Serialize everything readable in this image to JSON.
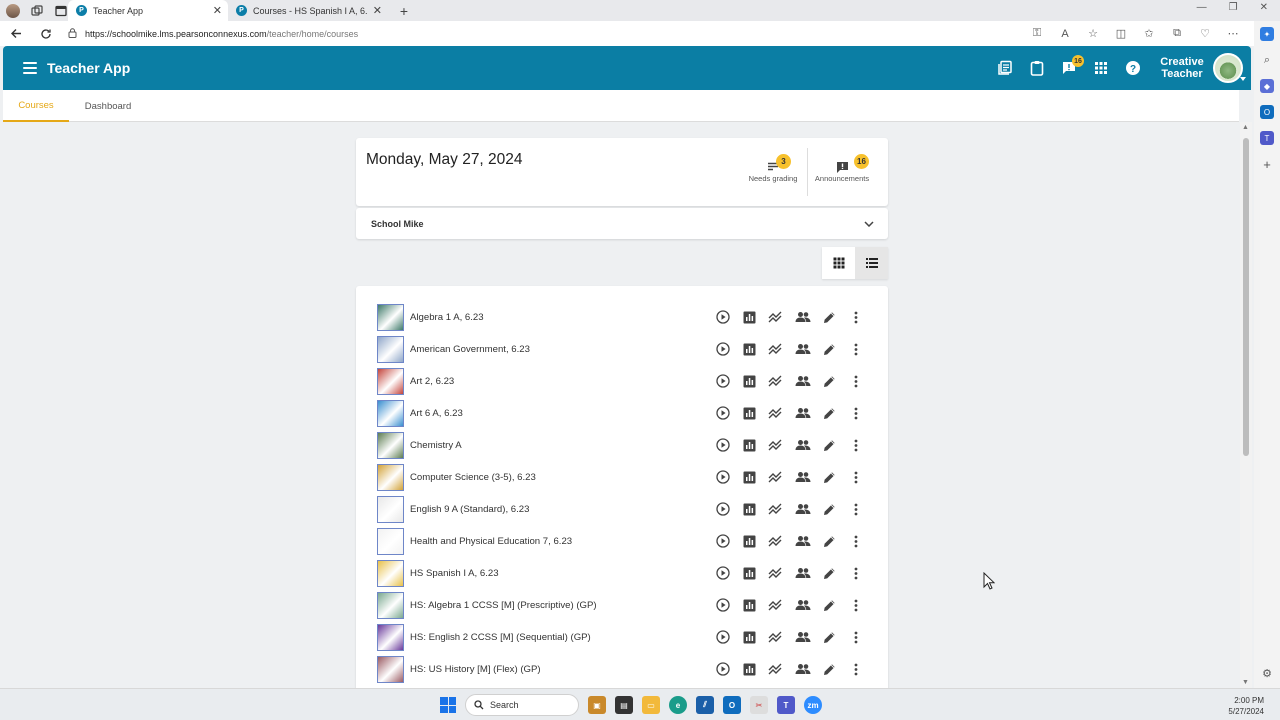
{
  "browser": {
    "tabs": [
      {
        "title": "Teacher App",
        "active": true
      },
      {
        "title": "Courses - HS Spanish I A, 6.23",
        "active": false
      }
    ],
    "url_host": "https://schoolmike.lms.pearsonconnexus.com",
    "url_path": "/teacher/home/courses"
  },
  "app": {
    "title": "Teacher App",
    "user_first": "Creative",
    "user_last": "Teacher",
    "messages_count": "16",
    "header_color": "#0b7ea4",
    "badge_color": "#f7c12d"
  },
  "subnav": {
    "tabs": [
      {
        "label": "Courses",
        "active": true
      },
      {
        "label": "Dashboard",
        "active": false
      }
    ],
    "active_color": "#e5a817"
  },
  "summary": {
    "date": "Monday, May 27, 2024",
    "needs_grading_count": "3",
    "needs_grading_label": "Needs grading",
    "announcements_count": "16",
    "announcements_label": "Announcements"
  },
  "school": {
    "name": "School Mike"
  },
  "courses": [
    {
      "name": "Algebra 1 A, 6.23",
      "thumb": "#3f7a6a"
    },
    {
      "name": "American Government, 6.23",
      "thumb": "#8fa6c9"
    },
    {
      "name": "Art 2, 6.23",
      "thumb": "#c4453c"
    },
    {
      "name": "Art 6 A, 6.23",
      "thumb": "#3a8fd0"
    },
    {
      "name": "Chemistry A",
      "thumb": "#5d7d52"
    },
    {
      "name": "Computer Science (3-5), 6.23",
      "thumb": "#d2a238"
    },
    {
      "name": "English 9 A (Standard), 6.23",
      "thumb": "#e8e8e8"
    },
    {
      "name": "Health and Physical Education 7, 6.23",
      "thumb": "#f2f2f2"
    },
    {
      "name": "HS Spanish I A, 6.23",
      "thumb": "#e8c14a"
    },
    {
      "name": "HS: Algebra 1 CCSS [M] (Prescriptive) (GP)",
      "thumb": "#7aa88f"
    },
    {
      "name": "HS: English 2 CCSS [M] (Sequential) (GP)",
      "thumb": "#6a3a9b"
    },
    {
      "name": "HS: US History [M] (Flex) (GP)",
      "thumb": "#9a5b63"
    }
  ],
  "taskbar": {
    "search_placeholder": "Search",
    "time": "2:00 PM",
    "date": "5/27/2024"
  }
}
